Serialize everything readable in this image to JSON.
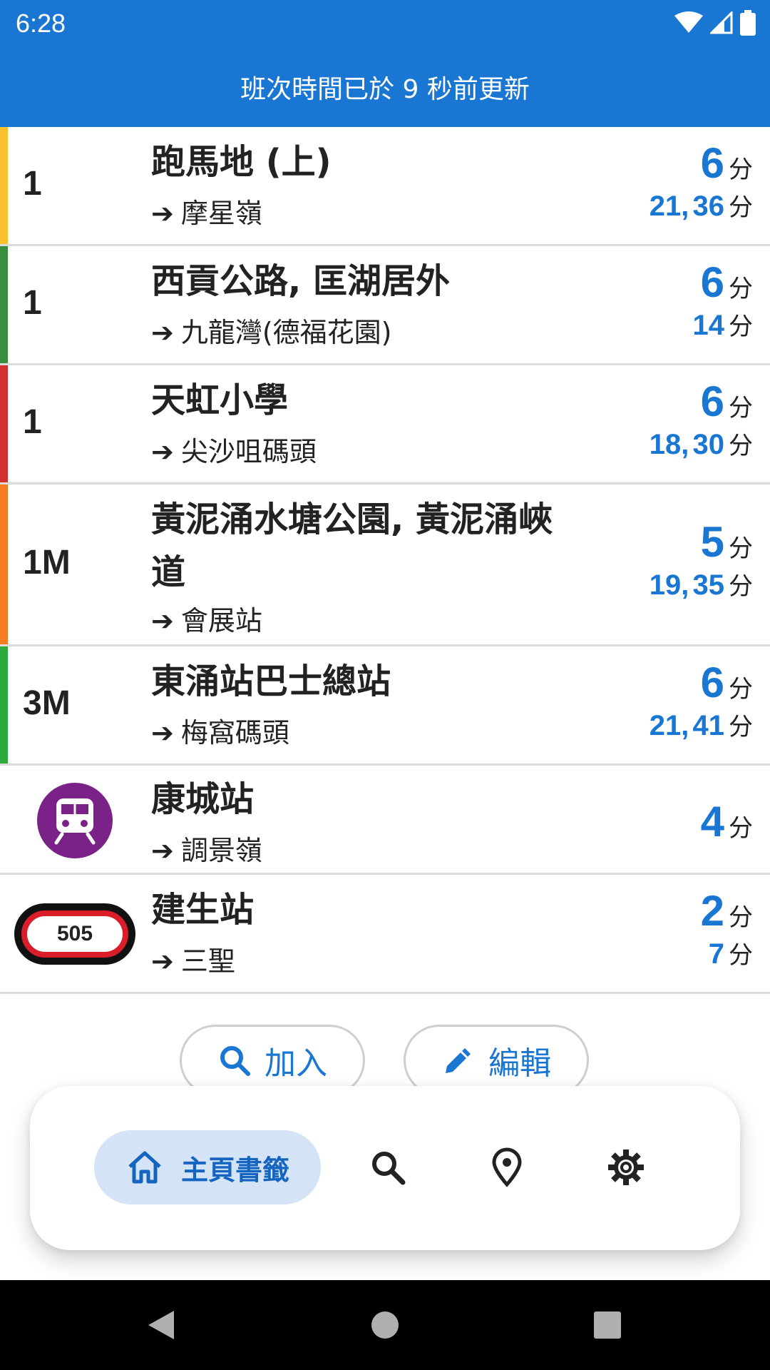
{
  "status_bar": {
    "time": "6:28"
  },
  "header": {
    "update_text": "班次時間已於 9 秒前更新"
  },
  "rows": [
    {
      "route": "1",
      "stop": "跑馬地 (上)",
      "dest": "摩星嶺",
      "stripe_color": "#fbc02d",
      "eta_main": "6",
      "eta_unit": "分",
      "eta_sub_a": "21",
      "eta_sub_b": "36",
      "eta_sub_unit": "分"
    },
    {
      "route": "1",
      "stop": "西貢公路, 匡湖居外",
      "dest": "九龍灣(德福花園)",
      "stripe_color": "#388e3c",
      "eta_main": "6",
      "eta_unit": "分",
      "eta_sub_a": "14",
      "eta_sub_unit": "分"
    },
    {
      "route": "1",
      "stop": "天虹小學",
      "dest": "尖沙咀碼頭",
      "stripe_color": "#d32f2f",
      "eta_main": "6",
      "eta_unit": "分",
      "eta_sub_a": "18",
      "eta_sub_b": "30",
      "eta_sub_unit": "分"
    },
    {
      "route": "1M",
      "stop": "黃泥涌水塘公園, 黃泥涌峽道",
      "dest": "會展站",
      "stripe_color": "#f57c20",
      "eta_main": "5",
      "eta_unit": "分",
      "eta_sub_a": "19",
      "eta_sub_b": "35",
      "eta_sub_unit": "分"
    },
    {
      "route": "3M",
      "stop": "東涌站巴士總站",
      "dest": "梅窩碼頭",
      "stripe_color": "#2eaa3c",
      "eta_main": "6",
      "eta_unit": "分",
      "eta_sub_a": "21",
      "eta_sub_b": "41",
      "eta_sub_unit": "分"
    },
    {
      "route_icon": "train-icon",
      "stop": "康城站",
      "dest": "調景嶺",
      "icon_color": "#7b2288",
      "eta_main": "4",
      "eta_unit": "分"
    },
    {
      "route_badge": "505",
      "stop": "建生站",
      "dest": "三聖",
      "badge_color": "#d91e2a",
      "eta_main": "2",
      "eta_unit": "分",
      "eta_sub_a": "7",
      "eta_sub_unit": "分"
    }
  ],
  "arrow_glyph": "➔",
  "comma": ",",
  "actions": {
    "add_label": "加入",
    "edit_label": "編輯"
  },
  "bottom_nav": {
    "home_label": "主頁書籤",
    "active_color": "#1565c0",
    "active_bg": "#d4e4f6"
  },
  "colors": {
    "primary": "#1976d2"
  }
}
